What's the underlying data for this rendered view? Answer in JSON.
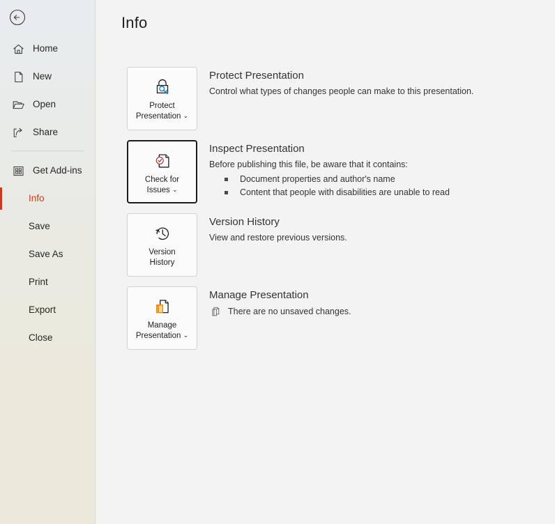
{
  "window": {
    "back_button_label": "Back",
    "accent_color": "#c43e1c",
    "sidebar_bg_top": "#e9ecef",
    "sidebar_bg_bottom": "#ebe9d9",
    "content_bg": "#f3f3f3"
  },
  "sidebar": {
    "items": [
      {
        "label": "Home",
        "icon": "home-icon",
        "active": false,
        "has_icon": true
      },
      {
        "label": "New",
        "icon": "new-file-icon",
        "active": false,
        "has_icon": true
      },
      {
        "label": "Open",
        "icon": "folder-icon",
        "active": false,
        "has_icon": true
      },
      {
        "label": "Share",
        "icon": "share-icon",
        "active": false,
        "has_icon": true
      },
      {
        "label": "Get Add-ins",
        "icon": "addins-icon",
        "active": false,
        "has_icon": true
      },
      {
        "label": "Info",
        "icon": "",
        "active": true,
        "has_icon": false
      },
      {
        "label": "Save",
        "icon": "",
        "active": false,
        "has_icon": false
      },
      {
        "label": "Save As",
        "icon": "",
        "active": false,
        "has_icon": false
      },
      {
        "label": "Print",
        "icon": "",
        "active": false,
        "has_icon": false
      },
      {
        "label": "Export",
        "icon": "",
        "active": false,
        "has_icon": false
      },
      {
        "label": "Close",
        "icon": "",
        "active": false,
        "has_icon": false
      }
    ]
  },
  "main": {
    "title": "Info",
    "sections": {
      "protect": {
        "tile_label_line1": "Protect",
        "tile_label_line2": "Presentation",
        "tile_caret": "⌄",
        "tile_icon": "lock-key-icon",
        "heading": "Protect Presentation",
        "description": "Control what types of changes people can make to this presentation."
      },
      "inspect": {
        "tile_label_line1": "Check for",
        "tile_label_line2": "Issues",
        "tile_caret": "⌄",
        "tile_icon": "document-check-icon",
        "heading": "Inspect Presentation",
        "description": "Before publishing this file, be aware that it contains:",
        "bullets": [
          "Document properties and author's name",
          "Content that people with disabilities are unable to read"
        ]
      },
      "version": {
        "tile_label_line1": "Version",
        "tile_label_line2": "History",
        "tile_icon": "clock-history-icon",
        "heading": "Version History",
        "description": "View and restore previous versions."
      },
      "manage": {
        "tile_label_line1": "Manage",
        "tile_label_line2": "Presentation",
        "tile_caret": "⌄",
        "tile_icon": "document-copy-orange-icon",
        "heading": "Manage Presentation",
        "status_icon": "document-copy-icon",
        "status_text": "There are no unsaved changes."
      }
    }
  }
}
